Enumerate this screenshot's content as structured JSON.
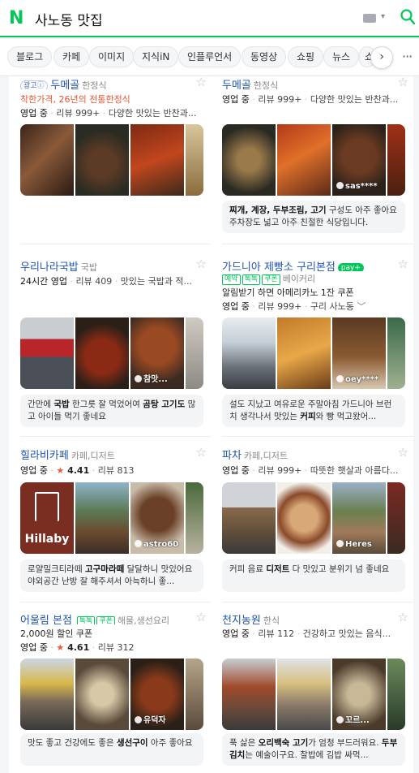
{
  "search": {
    "query": "사노동 맛집"
  },
  "tabs": [
    "블로그",
    "카페",
    "이미지",
    "지식iN",
    "인플루언서",
    "동영상",
    "쇼핑",
    "뉴스",
    "쇼"
  ],
  "tabs_next": "›",
  "tabs_more": "···",
  "left": [
    {
      "ad": "광고ⓘ",
      "name": "두메골",
      "category": "한정식",
      "promo": "착한가격, 26년의 전통한정식",
      "info": [
        "영업 중",
        "리뷰 999+",
        "다양한 맛있는 반찬과..."
      ],
      "photo_tag": "",
      "review": ""
    },
    {
      "name": "우리나라국밥",
      "category": "국밥",
      "info": [
        "24시간 영업",
        "리뷰 409",
        "맛있는 국밥과 적..."
      ],
      "photo_tag": "참맛...",
      "review_pre": "간만에 ",
      "review_b1": "국밥",
      "review_mid": " 한그릇 잘 먹었어여 ",
      "review_b2": "곰탕 고기도",
      "review_post": " 많고 아이들 먹기 좋네요"
    },
    {
      "name": "힐라비카페",
      "category": "카페,디저트",
      "info": [
        "영업 중"
      ],
      "rating": "4.41",
      "info_tail": "리뷰 813",
      "logo_text": "Hillaby",
      "photo_tag": "astro60",
      "review_pre": "로얄밀크티라떼 ",
      "review_b1": "고구마라떼",
      "review_mid": " 달달하니 맛있어요 야외공간 난방 잘 해주셔서 아늑하니 좋...",
      "review_b2": "",
      "review_post": ""
    },
    {
      "name": "어울림 본점",
      "badges": [
        "톡톡",
        "쿠폰"
      ],
      "category": "해물,생선요리",
      "coupon": "2,000원 할인 쿠폰",
      "info": [
        "영업 중"
      ],
      "rating": "4.61",
      "info_tail": "리뷰 312",
      "photo_tag": "유덕자",
      "review_pre": "맛도 좋고 건강에도 좋은 ",
      "review_b1": "생선구이",
      "review_mid": " 아주 좋아요",
      "review_b2": "",
      "review_post": ""
    }
  ],
  "right": [
    {
      "name": "두메골",
      "category": "한정식",
      "info": [
        "영업 중",
        "리뷰 999+",
        "다양한 맛있는 반찬과..."
      ],
      "photo_tag": "sas****",
      "review_pre": "",
      "review_b1": "찌개, 계장, 두부조림, 고기",
      "review_mid": " 구성도 아주 좋아요 주차장도 넓고 아주 친절한 식당입니다.",
      "review_b2": "",
      "review_post": ""
    },
    {
      "name": "가드니아 제빵소 구리본점",
      "npay": "pay+",
      "badges": [
        "예약",
        "톡톡",
        "쿠폰"
      ],
      "category": "베이커리",
      "coupon": "알림받기 하면 아메리카노 1잔 쿠폰",
      "info": [
        "영업 중",
        "리뷰 999+",
        "구리 사노동"
      ],
      "photo_tag": "oey****",
      "review_pre": "설도 지났고 여유로운 주말아침 가드니아 브런치 생각나서 맛있는 ",
      "review_b1": "커피",
      "review_mid": "와 빵 먹고왔어...",
      "review_b2": "",
      "review_post": ""
    },
    {
      "name": "파차",
      "category": "카페,디저트",
      "info": [
        "영업 중",
        "리뷰 999+",
        "따뜻한 햇살과 아름다..."
      ],
      "photo_tag": "Heres",
      "review_pre": "커피 음료 ",
      "review_b1": "디저트",
      "review_mid": " 다 맛있고 분위기 넘 좋네요",
      "review_b2": "",
      "review_post": ""
    },
    {
      "name": "천지농원",
      "category": "한식",
      "info": [
        "영업 중",
        "리뷰 112",
        "건강하고 맛있는 음식..."
      ],
      "photo_tag": "꼬르...",
      "review_pre": "푹 삶은 ",
      "review_b1": "오리백숙 고기",
      "review_mid": "가 엄청 부드러워요. ",
      "review_b2": "두부김치",
      "review_post": "는 예술이구요. 찰밥에 김밥 싸먹..."
    }
  ],
  "colors": {
    "brand": "#03c75a",
    "link": "#1f54b0",
    "promo": "#e8562f",
    "rating_star": "#f05a3c"
  }
}
